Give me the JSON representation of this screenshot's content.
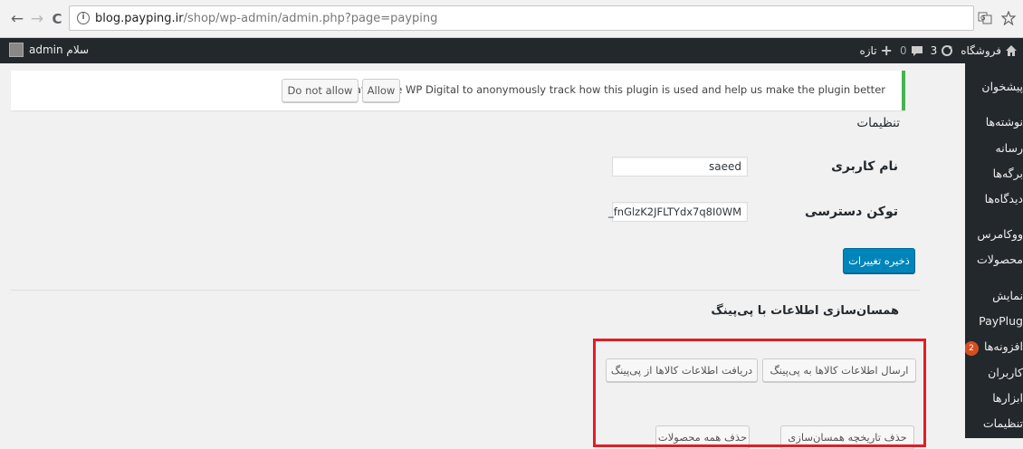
{
  "browser": {
    "back": "←",
    "forward": "→",
    "reload": "C",
    "info": "i",
    "url_domain": "blog.payping.ir",
    "url_path": "/shop/wp-admin/admin.php?page=payping",
    "icons": [
      "translate-icon",
      "star-icon"
    ]
  },
  "admin_bar": {
    "site_name": "فروشگاه",
    "updates_count": "3",
    "comments_count": "0",
    "new_label": "تازه",
    "greeting": "سلام admin"
  },
  "sidebar": {
    "items": [
      {
        "label": "پیشخوان"
      },
      {
        "label": "نوشته‌ها"
      },
      {
        "label": "رسانه"
      },
      {
        "label": "برگه‌ها"
      },
      {
        "label": "دیدگاه‌ها"
      },
      {
        "label": "ووکامرس"
      },
      {
        "label": "محصولات"
      },
      {
        "label": "نمایش"
      },
      {
        "label": "PayPlug"
      },
      {
        "label": "افزونه‌ها",
        "badge": "2"
      },
      {
        "label": "کاربران"
      },
      {
        "label": "ابزارها"
      },
      {
        "label": "تنظیمات"
      }
    ]
  },
  "notice": {
    "text": ".Allow Plateforme WP Digital to anonymously track how this plugin is used and help us make the plugin better",
    "allow": "Allow",
    "deny": "Do not allow"
  },
  "settings": {
    "title": "تنظیمات",
    "username_label": "نام کاربری",
    "username_value": "saeed",
    "token_label": "توکن دسترسی",
    "token_value": "_fnGlzK2JFLTYdx7q8I0WM",
    "save_label": "ذخیره تغییرات"
  },
  "sync": {
    "title": "همسان‌سازی اطلاعات با پی‌پینگ",
    "send_label": "ارسال اطلاعات کالاها به پی‌پینگ",
    "receive_label": "دریافت اطلاعات کالاها از پی‌پینگ",
    "delete_history_label": "حذف تاریخچه همسان‌سازی",
    "delete_all_label": "حذف همه محصولات"
  }
}
